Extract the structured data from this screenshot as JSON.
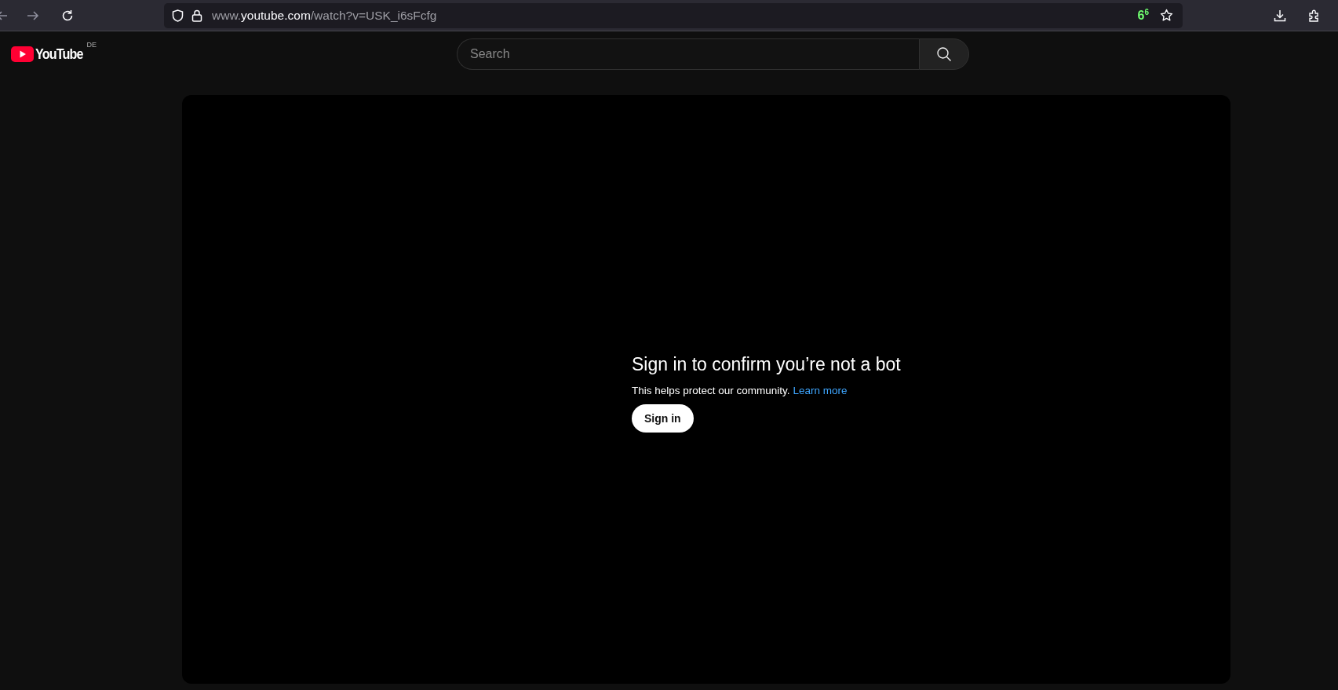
{
  "browser": {
    "url": {
      "prefix": "www.",
      "domain": "youtube.com",
      "path": "/watch?v=USK_i6sFcfg"
    },
    "badge": "6$^{6}$"
  },
  "header": {
    "logo_text": "YouTube",
    "region": "DE",
    "search": {
      "placeholder": "Search"
    }
  },
  "player": {
    "title": "Sign in to confirm you’re not a bot",
    "message": "This helps protect our community.",
    "link": "Learn more",
    "button": "Sign in"
  }
}
